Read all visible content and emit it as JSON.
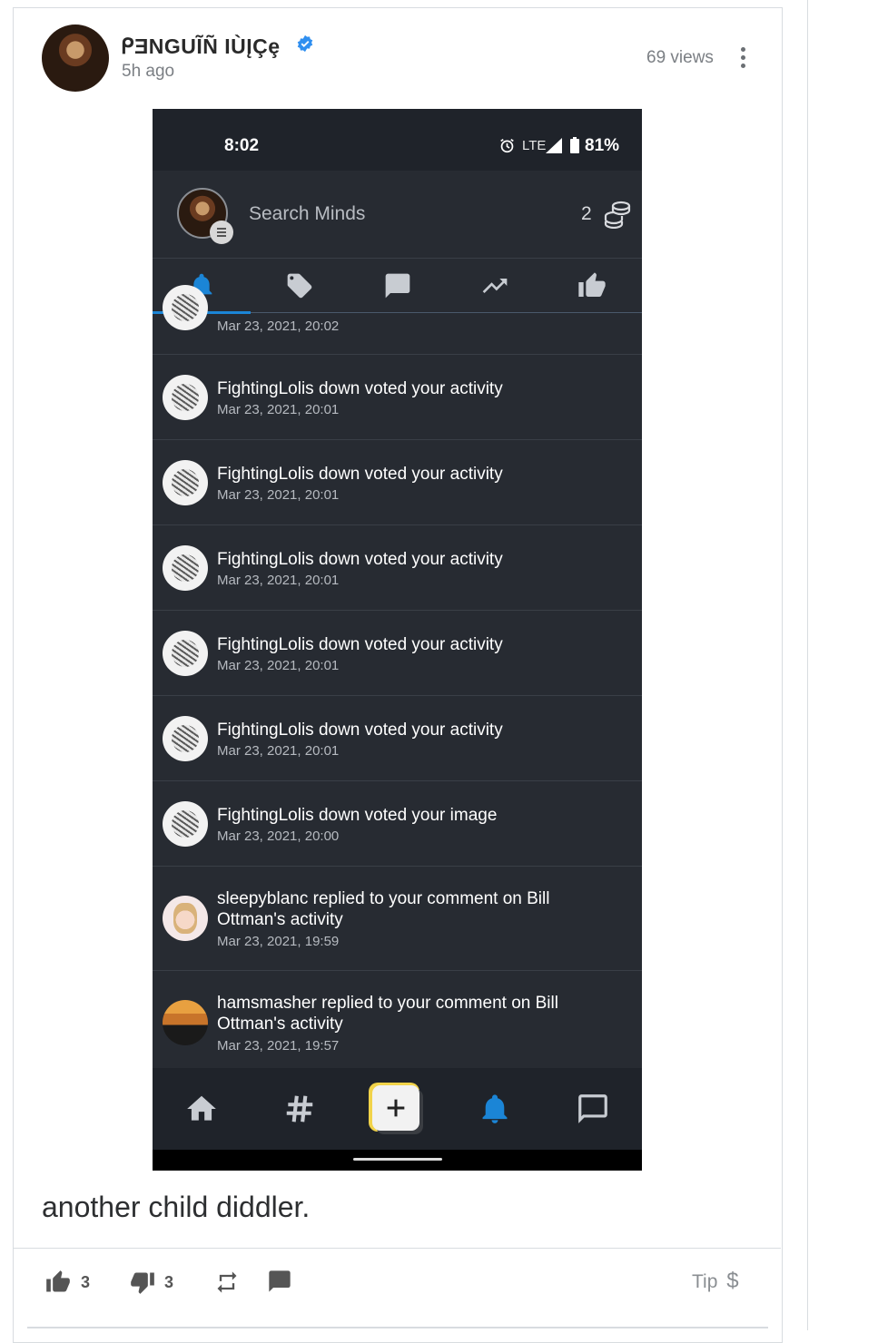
{
  "post": {
    "author": "ᑭƎNGUĨÑ ƖÙĮÇȩ",
    "time_ago": "5h ago",
    "views": "69 views",
    "caption": "another child diddler."
  },
  "phone": {
    "status": {
      "time": "8:02",
      "network": "LTE",
      "battery": "81%"
    },
    "search": {
      "placeholder": "Search Minds",
      "tokens": "2"
    },
    "tabs": [
      "bell-icon",
      "tag-icon",
      "chat-icon",
      "trending-icon",
      "thumbs-up-icon"
    ],
    "active_tab": "bell-icon",
    "notifications": [
      {
        "title": "",
        "date": "Mar 23, 2021, 20:02"
      },
      {
        "title": "FightingLolis down voted your activity",
        "date": "Mar 23, 2021, 20:01"
      },
      {
        "title": "FightingLolis down voted your activity",
        "date": "Mar 23, 2021, 20:01"
      },
      {
        "title": "FightingLolis down voted your activity",
        "date": "Mar 23, 2021, 20:01"
      },
      {
        "title": "FightingLolis down voted your activity",
        "date": "Mar 23, 2021, 20:01"
      },
      {
        "title": "FightingLolis down voted your activity",
        "date": "Mar 23, 2021, 20:01"
      },
      {
        "title": "FightingLolis down voted your image",
        "date": "Mar 23, 2021, 20:00"
      },
      {
        "title": "sleepyblanc replied to your comment on Bill Ottman's activity",
        "date": "Mar 23, 2021, 19:59"
      },
      {
        "title": "hamsmasher replied to your comment on Bill Ottman's activity",
        "date": "Mar 23, 2021, 19:57"
      }
    ],
    "bottom_nav": [
      "home-icon",
      "hashtag-icon",
      "compose-plus-icon",
      "bell-icon",
      "chat-icon"
    ],
    "accent_color": "#1b85d6"
  },
  "actions": {
    "upvotes": "3",
    "downvotes": "3",
    "tip_label": "Tip",
    "tip_symbol": "$"
  }
}
